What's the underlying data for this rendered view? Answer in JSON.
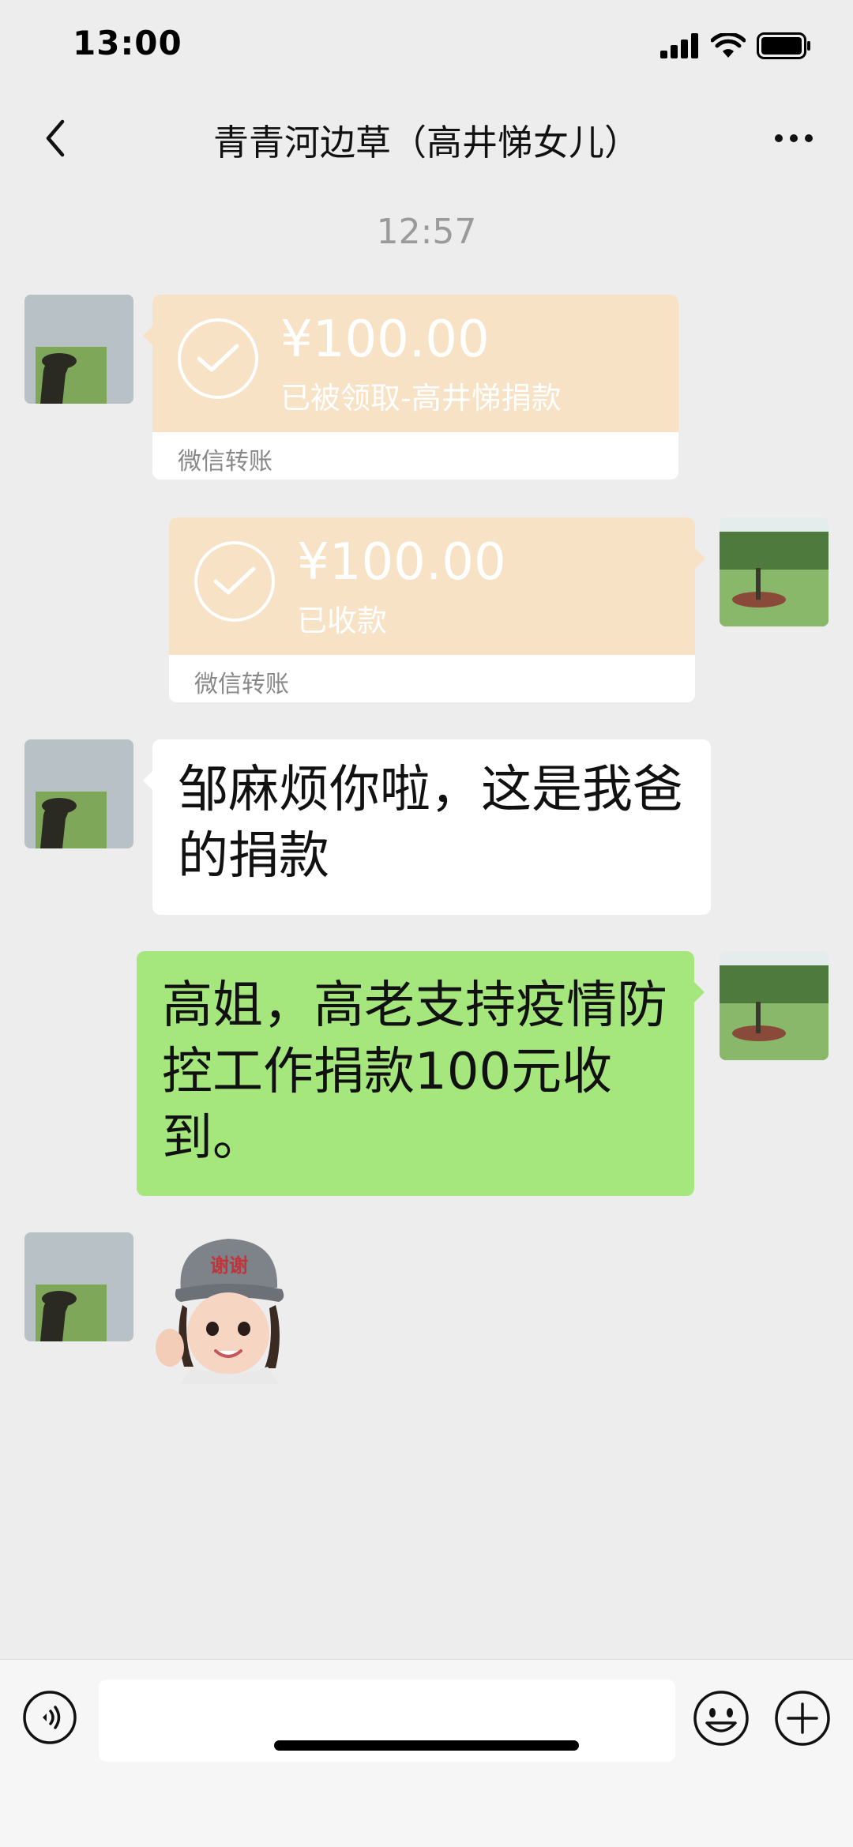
{
  "status_bar": {
    "time": "13:00"
  },
  "header": {
    "title": "青青河边草（高井悌女儿）",
    "back_icon": "chevron-left-icon",
    "more_icon": "ellipsis-icon"
  },
  "chat": {
    "timestamp": "12:57",
    "messages": [
      {
        "side": "left",
        "type": "transfer",
        "amount": "¥100.00",
        "status": "已被领取-高井悌捐款",
        "footer": "微信转账"
      },
      {
        "side": "right",
        "type": "transfer",
        "amount": "¥100.00",
        "status": "已收款",
        "footer": "微信转账"
      },
      {
        "side": "left",
        "type": "text",
        "text": "邹麻烦你啦，这是我爸的捐款"
      },
      {
        "side": "right",
        "type": "text",
        "text": "高姐，高老支持疫情防控工作捐款100元收到。"
      },
      {
        "side": "left",
        "type": "sticker",
        "sticker_text": "谢谢"
      }
    ]
  },
  "input_bar": {
    "voice_icon": "voice-icon",
    "emoji_icon": "emoji-icon",
    "plus_icon": "plus-icon",
    "value": ""
  },
  "colors": {
    "background": "#ededed",
    "transfer_card": "#f8e2c5",
    "own_bubble": "#a5e77c",
    "other_bubble": "#ffffff"
  }
}
